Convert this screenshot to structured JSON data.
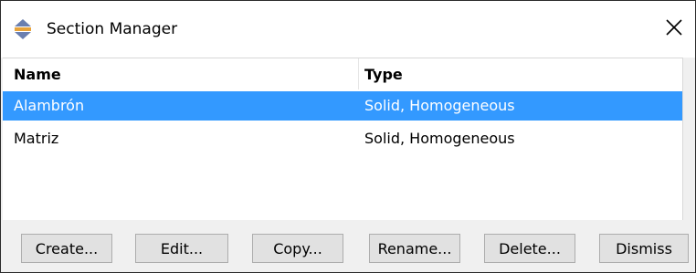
{
  "window": {
    "title": "Section Manager",
    "icon": "section-manager-icon",
    "close_icon": "close-icon"
  },
  "table": {
    "columns": [
      "Name",
      "Type"
    ],
    "rows": [
      {
        "name": "Alambrón",
        "type": "Solid, Homogeneous",
        "selected": true
      },
      {
        "name": "Matriz",
        "type": "Solid, Homogeneous",
        "selected": false
      }
    ]
  },
  "buttons": {
    "create": "Create...",
    "edit": "Edit...",
    "copy": "Copy...",
    "rename": "Rename...",
    "delete": "Delete...",
    "dismiss": "Dismiss"
  },
  "colors": {
    "selection": "#3399ff",
    "icon_blue": "#6a7fb0",
    "icon_orange": "#e8a33a"
  }
}
